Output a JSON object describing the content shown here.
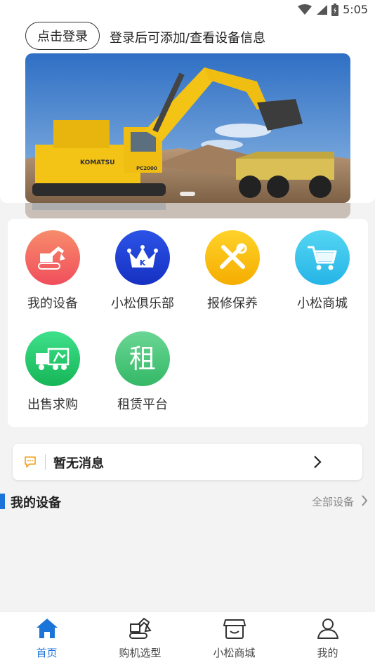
{
  "status_bar": {
    "time": "5:05"
  },
  "header": {
    "login_button": "点击登录",
    "login_hint": "登录后可添加/查看设备信息"
  },
  "banner": {
    "image": "komatsu-excavator-loading-dump-truck",
    "brand_text": "KOMATSU",
    "model_text": "PC2000"
  },
  "menu": {
    "items": [
      {
        "label": "我的设备",
        "icon": "excavator-icon",
        "color": "#f4625f"
      },
      {
        "label": "小松俱乐部",
        "icon": "crown-icon",
        "color": "#1e3fd8"
      },
      {
        "label": "报修保养",
        "icon": "wrench-screwdriver-icon",
        "color": "#f5b800"
      },
      {
        "label": "小松商城",
        "icon": "cart-icon",
        "color": "#32c1ea"
      },
      {
        "label": "出售求购",
        "icon": "truck-icon",
        "color": "#22c76a"
      },
      {
        "label": "租赁平台",
        "icon": "rent-icon",
        "icon_text": "租",
        "color": "#4ecb7e"
      }
    ]
  },
  "message": {
    "text": "暂无消息"
  },
  "my_devices": {
    "title": "我的设备",
    "link": "全部设备"
  },
  "tabbar": {
    "accent": "#1d74d8",
    "tabs": [
      {
        "label": "首页",
        "icon": "home-icon",
        "active": true
      },
      {
        "label": "购机选型",
        "icon": "excavator-outline-icon",
        "active": false
      },
      {
        "label": "小松商城",
        "icon": "store-icon",
        "active": false
      },
      {
        "label": "我的",
        "icon": "user-icon",
        "active": false
      }
    ]
  }
}
